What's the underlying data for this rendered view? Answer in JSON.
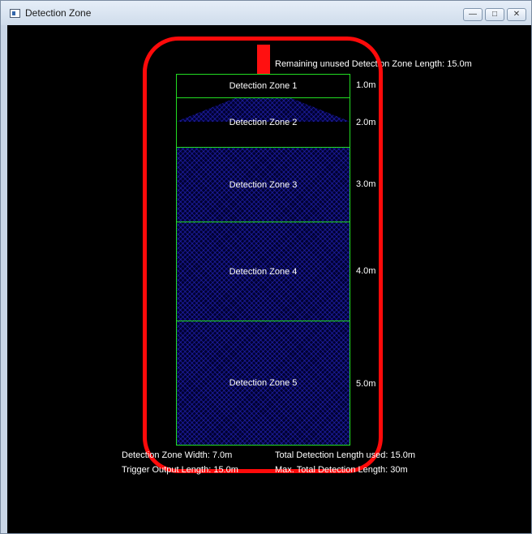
{
  "window": {
    "title": "Detection Zone",
    "min_symbol": "—",
    "max_symbol": "□",
    "close_symbol": "✕"
  },
  "canvas": {
    "remaining_text": "Remaining unused Detection Zone Length: 15.0m",
    "zones": [
      {
        "label": "Detection Zone 1",
        "length": "1.0m"
      },
      {
        "label": "Detection Zone 2",
        "length": "2.0m"
      },
      {
        "label": "Detection Zone 3",
        "length": "3.0m"
      },
      {
        "label": "Detection Zone 4",
        "length": "4.0m"
      },
      {
        "label": "Detection Zone 5",
        "length": "5.0m"
      }
    ],
    "info": {
      "width": "Detection Zone Width: 7.0m",
      "trigger": "Trigger Output Length: 15.0m",
      "total_used": "Total Detection Length used: 15.0m",
      "max_total": "Max. Total Detection Length: 30m"
    }
  },
  "colors": {
    "zone_border": "#22dd22",
    "fill_hatch": "#2828c8",
    "highlight": "#ff0a0a",
    "background": "#000000"
  }
}
